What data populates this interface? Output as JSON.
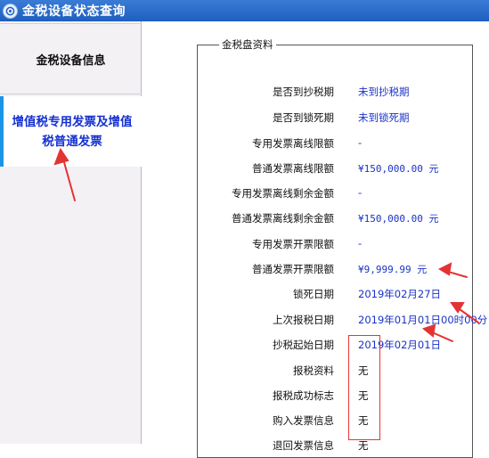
{
  "window": {
    "title": "金税设备状态查询",
    "icon": "app-circle-icon"
  },
  "sidebar": {
    "items": [
      {
        "label": "金税设备信息",
        "selected": false
      },
      {
        "label": "增值税专用发票及增值税普通发票",
        "selected": true
      }
    ]
  },
  "panel": {
    "legend": "金税盘资料",
    "rows": [
      {
        "label": "是否到抄税期",
        "value": "未到抄税期"
      },
      {
        "label": "是否到锁死期",
        "value": "未到锁死期"
      },
      {
        "label": "专用发票离线限额",
        "value": "-"
      },
      {
        "label": "普通发票离线限额",
        "value": "¥150,000.00 元"
      },
      {
        "label": "专用发票离线剩余金额",
        "value": "-"
      },
      {
        "label": "普通发票离线剩余金额",
        "value": "¥150,000.00 元"
      },
      {
        "label": "专用发票开票限额",
        "value": "-"
      },
      {
        "label": "普通发票开票限额",
        "value": "¥9,999.99 元"
      },
      {
        "label": "锁死日期",
        "value": "2019年02月27日"
      },
      {
        "label": "上次报税日期",
        "value": "2019年01月01日00时00分"
      },
      {
        "label": "抄税起始日期",
        "value": "2019年02月01日"
      },
      {
        "label": "报税资料",
        "value": "无"
      },
      {
        "label": "报税成功标志",
        "value": "无"
      },
      {
        "label": "购入发票信息",
        "value": "无"
      },
      {
        "label": "退回发票信息",
        "value": "无"
      }
    ]
  },
  "colors": {
    "titlebar": "#1d5fbf",
    "selected_nav_text": "#1431d2",
    "value_text": "#1a32c8",
    "annotation": "#e33333"
  }
}
